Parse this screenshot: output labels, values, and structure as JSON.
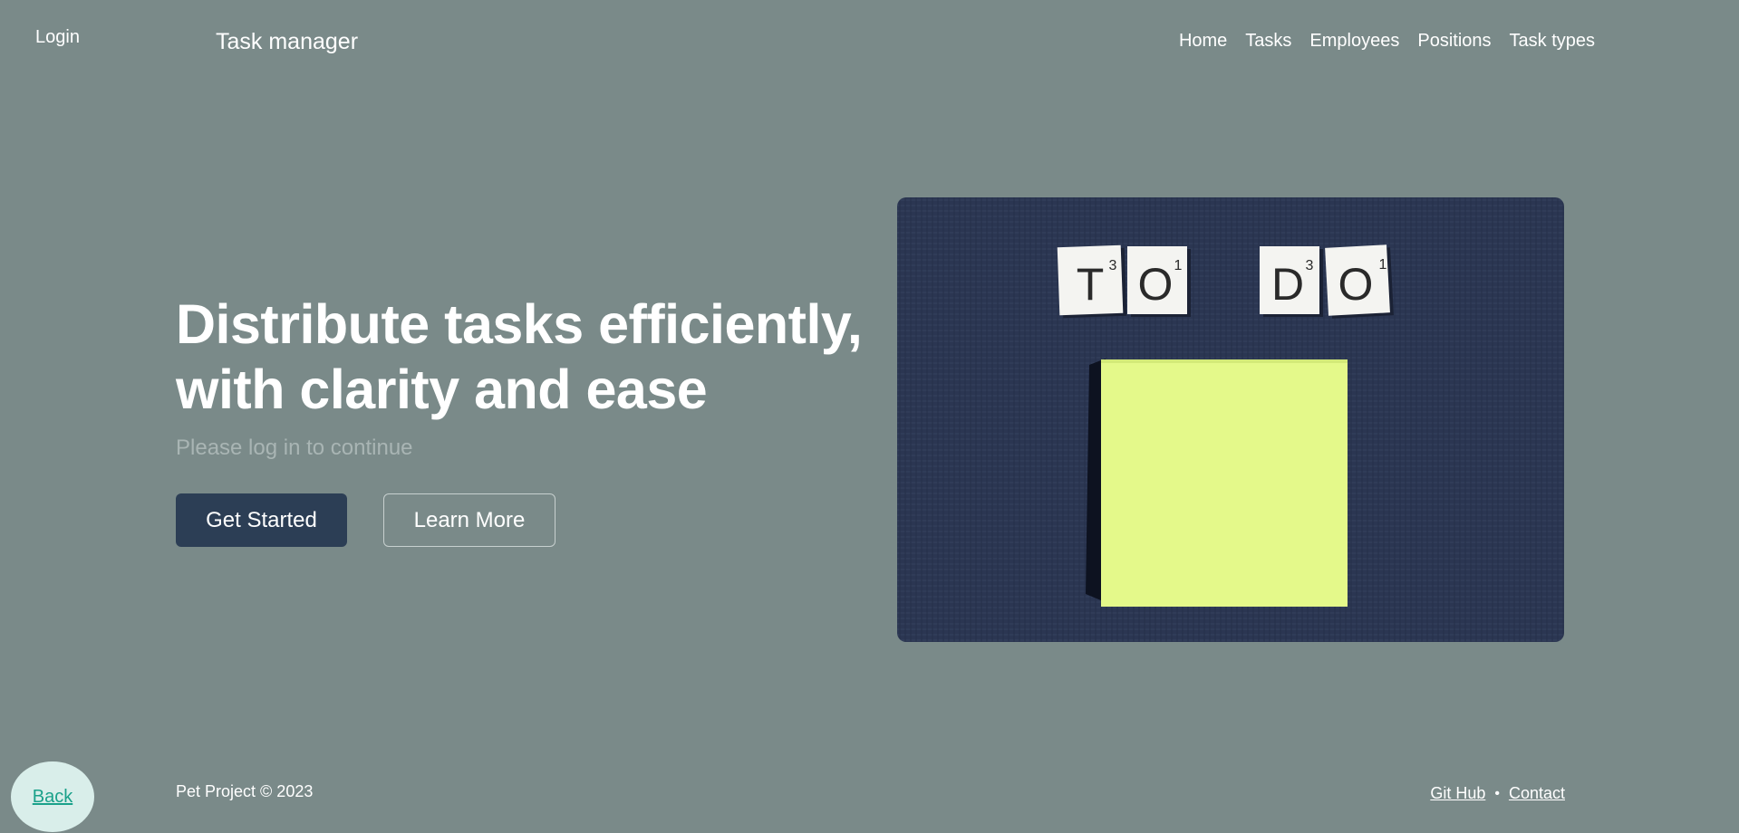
{
  "header": {
    "login_label": "Login",
    "brand": "Task manager",
    "nav": [
      "Home",
      "Tasks",
      "Employees",
      "Positions",
      "Task types"
    ]
  },
  "hero": {
    "title_line1": "Distribute tasks efficiently,",
    "title_line2": "with clarity and ease",
    "subtitle": "Please log in to continue",
    "primary_button": "Get Started",
    "secondary_button": "Learn More"
  },
  "image": {
    "tiles": [
      {
        "letter": "T",
        "score": "3"
      },
      {
        "letter": "O",
        "score": "1"
      },
      {
        "letter": "D",
        "score": "3"
      },
      {
        "letter": "O",
        "score": "1"
      }
    ]
  },
  "footer": {
    "copyright": "Pet Project © 2023",
    "links": [
      "Git Hub",
      "Contact"
    ],
    "separator": "•"
  },
  "back_label": "Back",
  "colors": {
    "background": "#7a8a89",
    "primary_button": "#2c3e55",
    "image_bg": "#2b3652",
    "sticky_note": "#e4f98a",
    "back_bg": "#d9eeea",
    "back_text": "#1aa18a"
  }
}
